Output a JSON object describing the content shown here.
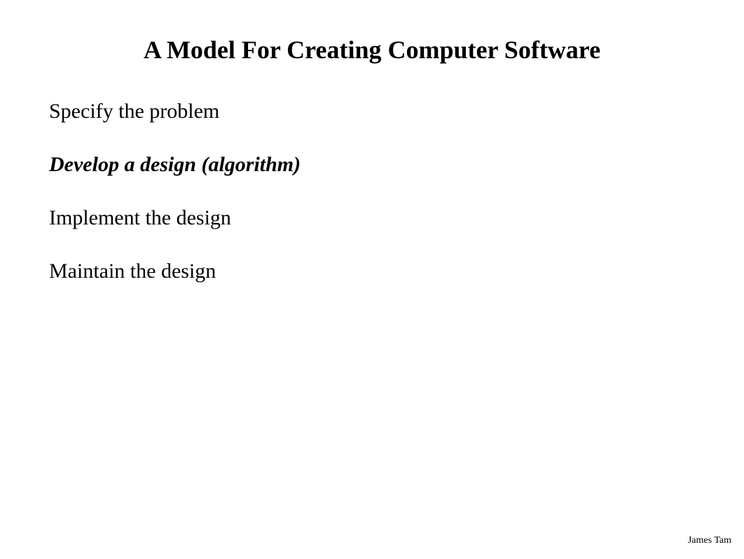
{
  "slide": {
    "title": "A Model For Creating Computer Software",
    "bullets": [
      {
        "text": "Specify the problem",
        "emphasized": false
      },
      {
        "text": "Develop a design (algorithm)",
        "emphasized": true
      },
      {
        "text": "Implement the design",
        "emphasized": false
      },
      {
        "text": "Maintain the design",
        "emphasized": false
      }
    ],
    "footer": "James Tam"
  }
}
